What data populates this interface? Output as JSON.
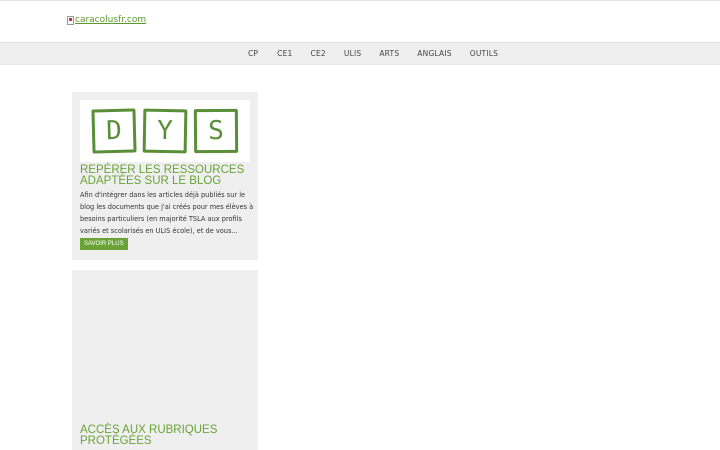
{
  "header": {
    "logo_alt": "caracolusfr.com"
  },
  "nav": {
    "items": [
      "CP",
      "CE1",
      "CE2",
      "ULIS",
      "ARTS",
      "ANGLAIS",
      "OUTILS"
    ]
  },
  "posts": [
    {
      "thumb_letters": [
        "D",
        "Y",
        "S"
      ],
      "title": "REPÉRER LES RESSOURCES ADAPTÉES SUR LE BLOG",
      "excerpt": "Afin d'intégrer dans les articles déjà publiés sur le blog les documents que j'ai créés pour mes élèves à besoins particuliers (en majorité TSLA  aux profils variés et scolarisés en ULIS école), et de vous...",
      "button": "SAVOIR PLUS"
    },
    {
      "title": "ACCÈS AUX RUBRIQUES PROTÉGÉES"
    }
  ],
  "colors": {
    "accent": "#6aa338",
    "nav_bg": "#efefef",
    "card_bg": "#efefef"
  }
}
